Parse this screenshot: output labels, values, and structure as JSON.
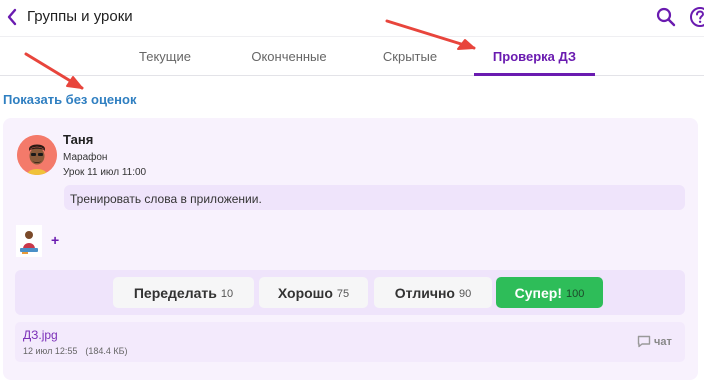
{
  "header": {
    "title": "Группы и уроки"
  },
  "tabs": [
    {
      "label": "Текущие"
    },
    {
      "label": "Оконченные"
    },
    {
      "label": "Скрытые"
    },
    {
      "label": "Проверка ДЗ",
      "active": true
    }
  ],
  "filter": {
    "show_without_grades": "Показать без оценок"
  },
  "card": {
    "student_name": "Таня",
    "group": "Марафон",
    "lesson": "Урок 11 июл 11:00",
    "task_text": "Тренировать слова в приложении.",
    "add_label": "+",
    "grades": [
      {
        "label": "Переделать",
        "count": "10"
      },
      {
        "label": "Хорошо",
        "count": "75"
      },
      {
        "label": "Отлично",
        "count": "90"
      },
      {
        "label": "Супер!",
        "count": "100",
        "highlight": true
      }
    ],
    "file": {
      "name": "ДЗ.jpg",
      "date": "12 июл 12:55",
      "size": "(184.4 КБ)",
      "chat_label": "чат"
    }
  },
  "colors": {
    "accent": "#6a1bb0",
    "link": "#2f7fc1",
    "super": "#2ebd59",
    "card_bg": "#f8f2fd",
    "arrow": "#e8453c"
  }
}
